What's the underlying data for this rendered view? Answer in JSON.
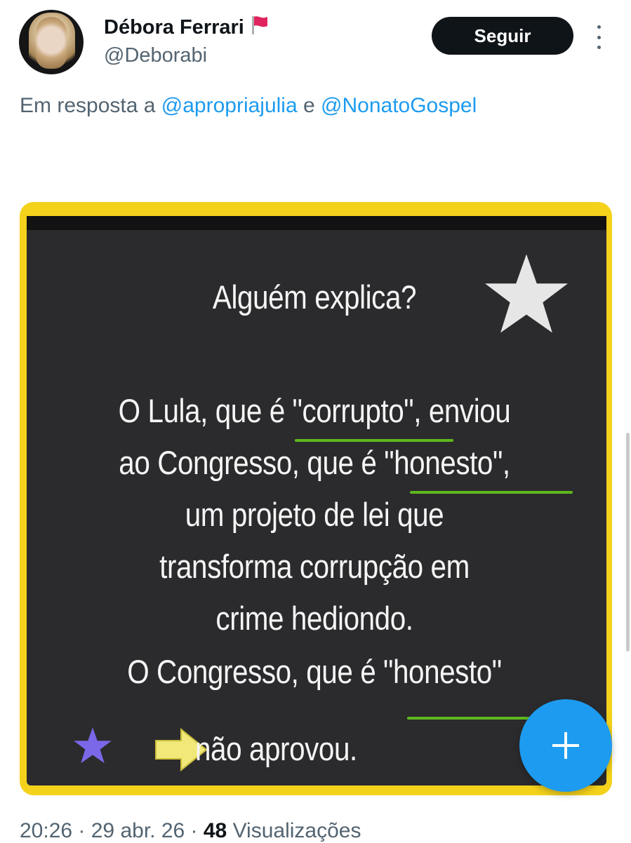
{
  "author": {
    "name": "Débora Ferrari",
    "handle": "@Deborabi",
    "flag_icon": "red-flag-icon"
  },
  "actions": {
    "follow_label": "Seguir",
    "more_icon": "more-vertical-icon"
  },
  "reply": {
    "prefix": "Em resposta a",
    "mention_1": "@apropriajulia",
    "connector": "e",
    "mention_2": "@NonatoGospel"
  },
  "media": {
    "line_1": "Alguém explica?",
    "line_2": "O Lula, que é \"corrupto\", enviou",
    "line_3": "ao Congresso, que é \"honesto\",",
    "line_4": "um projeto de lei que",
    "line_5": "transforma corrupção em",
    "line_6": "crime hediondo.",
    "line_7": "O Congresso, que é \"honesto\"",
    "line_8": "não aprovou.",
    "colors": {
      "border": "#f4d21c",
      "background": "#2b2b2d",
      "underline": "#5fb81e",
      "white_star": "#e6e6e6",
      "purple_star": "#7a68e8",
      "arrow": "#f1e87a"
    }
  },
  "footer": {
    "time": "20:26",
    "sep1": " · ",
    "date": "29 abr. 26",
    "sep2": " · ",
    "views_count": "48",
    "views_label": "Visualizações"
  },
  "fab": {
    "icon": "plus-icon"
  },
  "accent": "#1d9bf0"
}
